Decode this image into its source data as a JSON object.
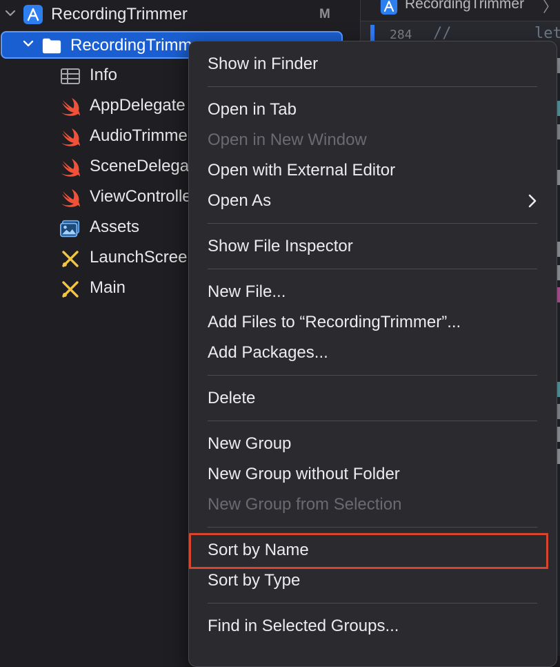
{
  "navigator": {
    "project": {
      "label": "RecordingTrimmer",
      "status": "M",
      "icon": "xcode-project-icon"
    },
    "group": {
      "label": "RecordingTrimmer",
      "icon": "folder-icon"
    },
    "files": [
      {
        "label": "Info",
        "icon": "plist-table-icon"
      },
      {
        "label": "AppDelegate",
        "icon": "swift-icon"
      },
      {
        "label": "AudioTrimmer",
        "icon": "swift-icon"
      },
      {
        "label": "SceneDelegate",
        "icon": "swift-icon"
      },
      {
        "label": "ViewController",
        "icon": "swift-icon"
      },
      {
        "label": "Assets",
        "icon": "asset-catalog-icon"
      },
      {
        "label": "LaunchScreen",
        "icon": "storyboard-icon"
      },
      {
        "label": "Main",
        "icon": "storyboard-icon"
      }
    ]
  },
  "editor": {
    "breadcrumb_title": "RecordingTrimmer",
    "breadcrumb_separator": "〉",
    "line_number": "284",
    "code_comment": "//",
    "code_keyword": "let"
  },
  "context_menu": {
    "items": [
      {
        "label": "Show in Finder",
        "enabled": true
      },
      {
        "label": "Open in Tab",
        "enabled": true
      },
      {
        "label": "Open in New Window",
        "enabled": false
      },
      {
        "label": "Open with External Editor",
        "enabled": true
      },
      {
        "label": "Open As",
        "enabled": true,
        "submenu": true
      },
      {
        "label": "Show File Inspector",
        "enabled": true
      },
      {
        "label": "New File...",
        "enabled": true
      },
      {
        "label": "Add Files to “RecordingTrimmer”...",
        "enabled": true
      },
      {
        "label": "Add Packages...",
        "enabled": true
      },
      {
        "label": "Delete",
        "enabled": true
      },
      {
        "label": "New Group",
        "enabled": true
      },
      {
        "label": "New Group without Folder",
        "enabled": true
      },
      {
        "label": "New Group from Selection",
        "enabled": false
      },
      {
        "label": "Sort by Name",
        "enabled": true,
        "highlighted": true
      },
      {
        "label": "Sort by Type",
        "enabled": true
      },
      {
        "label": "Find in Selected Groups...",
        "enabled": true
      }
    ]
  },
  "colors": {
    "selection": "#1a5fd1",
    "highlight_box": "#d8452f",
    "swift": "#f05138",
    "storyboard": "#f4c542",
    "accent": "#2f7bf6"
  }
}
